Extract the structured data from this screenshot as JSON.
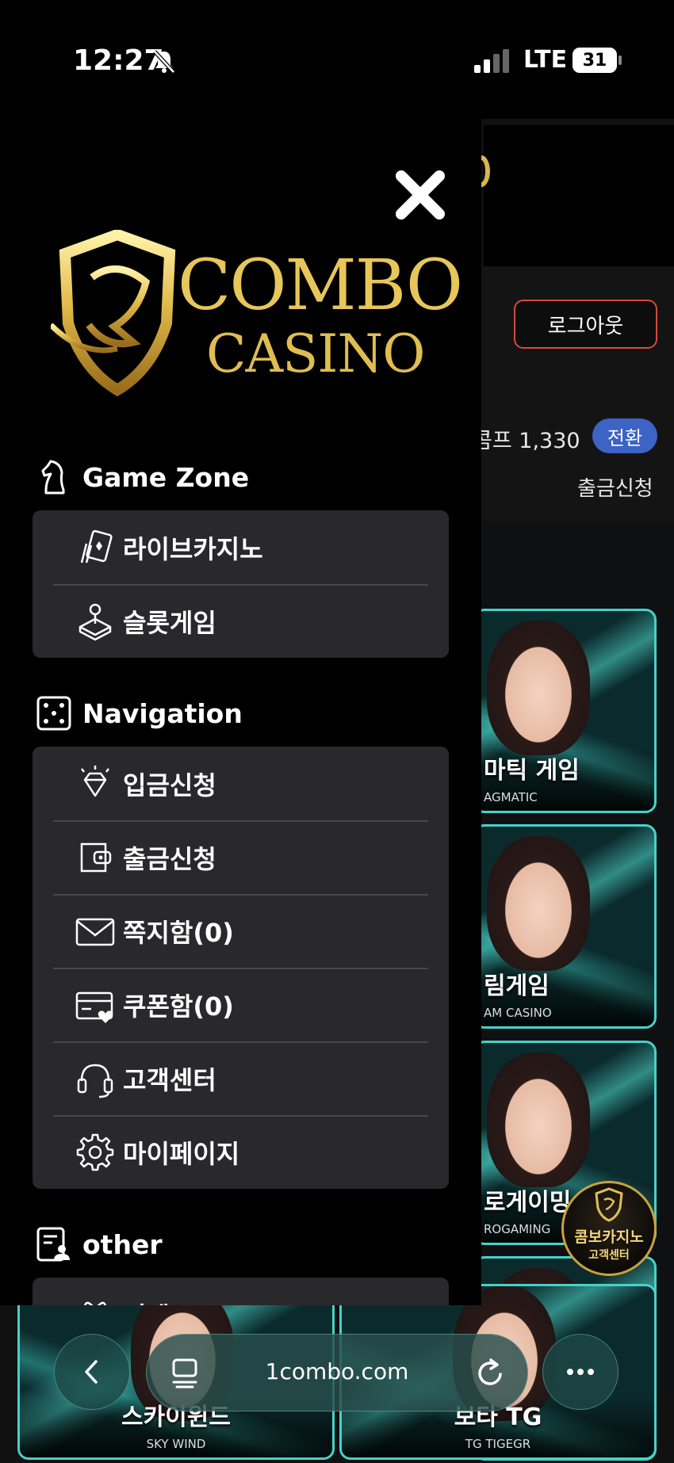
{
  "status_bar": {
    "time": "12:27",
    "network": "LTE",
    "battery": "31",
    "icons": [
      "bell-muted-icon",
      "signal-icon",
      "battery-icon"
    ]
  },
  "background_page": {
    "logout_label": "로그아웃",
    "points_text": "콤프 1,330",
    "convert_label": "전환",
    "withdraw_label": "출금신청",
    "games": [
      {
        "ko": "마틱 게임",
        "en": "AGMATIC"
      },
      {
        "ko": "림게임",
        "en": "AM CASINO"
      },
      {
        "ko": "로게이밍",
        "en": "ROGAMING"
      },
      {
        "ko": "스카이윈드",
        "en": "SKY WIND"
      },
      {
        "ko": "보타 TG",
        "en": "TG TIGEGR"
      }
    ],
    "support_badge": {
      "line1": "콤보카지노",
      "line2": "고객센터"
    }
  },
  "drawer": {
    "close_icon": "close-icon",
    "brand": {
      "line1": "COMBO",
      "line2": "CASINO"
    },
    "sections": [
      {
        "label": "Game Zone",
        "icon": "chess-knight-icon",
        "items": [
          {
            "label": "라이브카지노",
            "icon": "cards-icon"
          },
          {
            "label": "슬롯게임",
            "icon": "joystick-icon"
          }
        ]
      },
      {
        "label": "Navigation",
        "icon": "dice-icon",
        "items": [
          {
            "label": "입금신청",
            "icon": "diamond-icon"
          },
          {
            "label": "출금신청",
            "icon": "wallet-icon"
          },
          {
            "label": "쪽지함(0)",
            "icon": "envelope-icon"
          },
          {
            "label": "쿠폰함(0)",
            "icon": "coupon-card-icon"
          },
          {
            "label": "고객센터",
            "icon": "headset-icon"
          },
          {
            "label": "마이페이지",
            "icon": "gear-icon"
          }
        ]
      },
      {
        "label": "other",
        "icon": "profile-list-icon",
        "items": [
          {
            "label": "이벤트",
            "icon": "gift-icon"
          }
        ]
      }
    ]
  },
  "browser": {
    "url": "1combo.com",
    "icons": [
      "back-icon",
      "tabs-icon",
      "reload-icon",
      "more-icon"
    ]
  },
  "colors": {
    "drawer_bg": "#000000",
    "menu_card_bg": "#29292b",
    "divider": "#48484b",
    "logout_border": "#d9483b",
    "convert_badge": "#3d63c4",
    "card_accent": "#46d2c8",
    "gold": "#d8b84a"
  }
}
